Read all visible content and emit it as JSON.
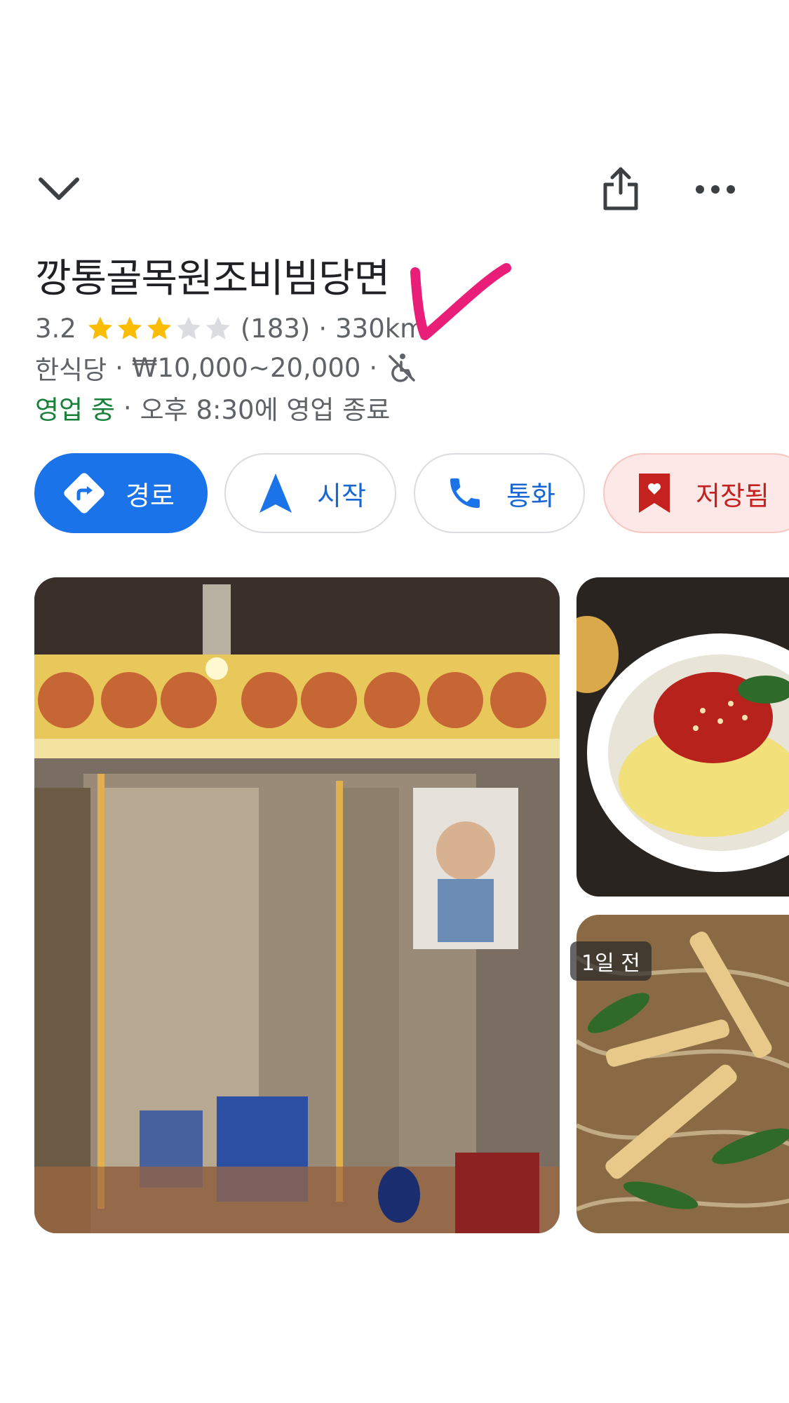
{
  "place": {
    "name": "깡통골목원조비빔당면",
    "rating": "3.2",
    "rating_value": 3.2,
    "rating_max": 5,
    "review_count": "(183)",
    "distance": "330km",
    "category": "한식당",
    "price_range": "₩10,000~20,000",
    "status": "영업 중",
    "hours_note": "오후 8:30에 영업 종료"
  },
  "actions": {
    "route": "경로",
    "start": "시작",
    "call": "통화",
    "saved": "저장됨"
  },
  "photos": {
    "recent_badge": "1일 전"
  },
  "colors": {
    "accent_blue": "#1a73e8",
    "open_green": "#188038",
    "saved_red": "#c5221f",
    "star_yellow": "#fbbc04",
    "annotation_pink": "#e91e78"
  }
}
